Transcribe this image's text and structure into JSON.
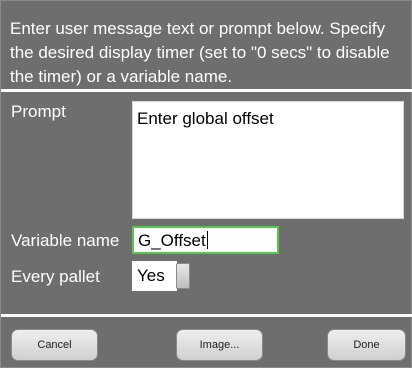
{
  "dialog": {
    "instructions": "Enter user message text or prompt below. Specify the desired display timer (set to \"0 secs\" to disable the timer) or a variable name.",
    "prompt_label": "Prompt",
    "prompt_value": "Enter global offset",
    "variable_label": "Variable name",
    "variable_value": "G_Offset",
    "pallet_label": "Every pallet",
    "pallet_value": "Yes",
    "buttons": {
      "cancel": "Cancel",
      "image": "Image...",
      "done": "Done"
    },
    "colors": {
      "background": "#6e6e6e",
      "input_focus_border": "#55c94b"
    }
  }
}
